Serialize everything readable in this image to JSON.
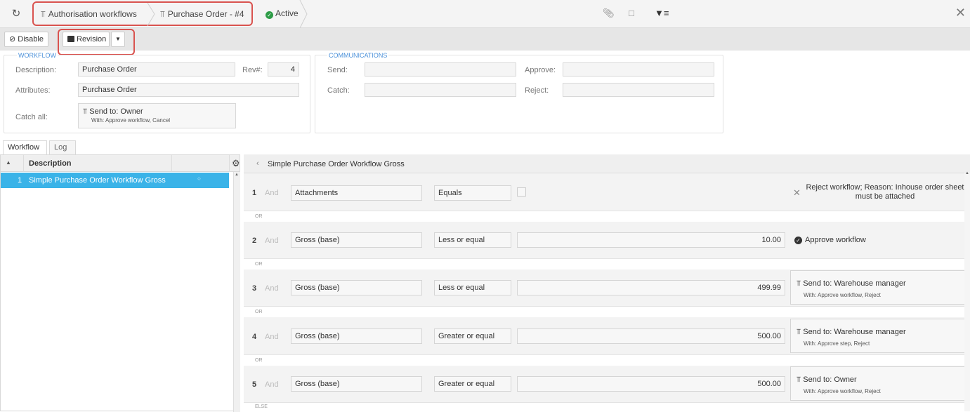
{
  "header": {
    "breadcrumbs": [
      "Authorisation workflows",
      "Purchase Order - #4"
    ],
    "status": "Active"
  },
  "toolbar": {
    "disable_label": "Disable",
    "revision_label": "Revision"
  },
  "workflow": {
    "section_title": "WORKFLOW",
    "description_label": "Description:",
    "description_value": "Purchase Order",
    "rev_label": "Rev#:",
    "rev_value": "4",
    "attributes_label": "Attributes:",
    "attributes_value": "Purchase Order",
    "catch_all_label": "Catch all:",
    "catch_all_send": "Send to: Owner",
    "catch_all_with": "With:  Approve workflow, Cancel"
  },
  "communications": {
    "section_title": "COMMUNICATIONS",
    "send_label": "Send:",
    "approve_label": "Approve:",
    "catch_label": "Catch:",
    "reject_label": "Reject:"
  },
  "tabs": [
    "Workflow",
    "Log"
  ],
  "list": {
    "column": "Description",
    "rows": [
      {
        "num": "1",
        "description": "Simple Purchase Order Workflow Gross"
      }
    ]
  },
  "detail": {
    "title": "Simple Purchase Order Workflow Gross",
    "and_label": "And",
    "or_label": "OR",
    "else_label": "ELSE",
    "rules": [
      {
        "num": "1",
        "field": "Attachments",
        "op": "Equals",
        "value": "",
        "action": "Reject workflow; Reason: Inhouse order sheet must be attached",
        "with": ""
      },
      {
        "num": "2",
        "field": "Gross (base)",
        "op": "Less or equal",
        "value": "10.00",
        "action": "Approve workflow",
        "with": ""
      },
      {
        "num": "3",
        "field": "Gross (base)",
        "op": "Less or equal",
        "value": "499.99",
        "action": "Send to: Warehouse manager",
        "with": "With:  Approve workflow, Reject"
      },
      {
        "num": "4",
        "field": "Gross (base)",
        "op": "Greater or equal",
        "value": "500.00",
        "action": "Send to: Warehouse manager",
        "with": "With:  Approve step, Reject"
      },
      {
        "num": "5",
        "field": "Gross (base)",
        "op": "Greater or equal",
        "value": "500.00",
        "action": "Send to: Owner",
        "with": "With:  Approve workflow, Reject"
      }
    ]
  }
}
